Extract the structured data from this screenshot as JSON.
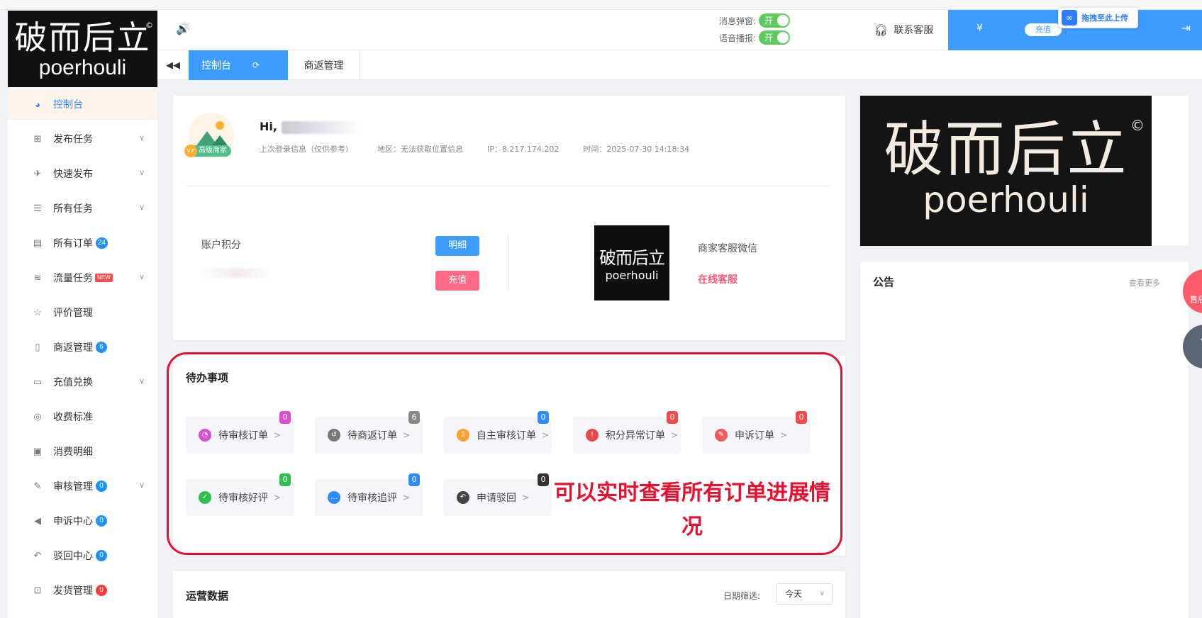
{
  "logo": {
    "cn": "破而后立",
    "en": "poerhouli",
    "reg": "©"
  },
  "sidebar": {
    "items": [
      {
        "label": "控制台",
        "icon": "dashboard-icon",
        "glyph": "◕",
        "active": true
      },
      {
        "label": "发布任务",
        "icon": "publish-icon",
        "glyph": "⊞",
        "chevron": true
      },
      {
        "label": "快速发布",
        "icon": "plane-icon",
        "glyph": "✈",
        "chevron": true
      },
      {
        "label": "所有任务",
        "icon": "task-list-icon",
        "glyph": "☰",
        "chevron": true
      },
      {
        "label": "所有订单",
        "icon": "order-icon",
        "glyph": "▤",
        "badge": "24"
      },
      {
        "label": "流量任务",
        "icon": "traffic-icon",
        "glyph": "≋",
        "newtag": "NEW",
        "chevron": true
      },
      {
        "label": "评价管理",
        "icon": "star-icon",
        "glyph": "☆"
      },
      {
        "label": "商返管理",
        "icon": "return-icon",
        "glyph": "▯",
        "badge": "6"
      },
      {
        "label": "充值兑换",
        "icon": "card-icon",
        "glyph": "▭",
        "chevron": true
      },
      {
        "label": "收费标准",
        "icon": "coins-icon",
        "glyph": "◎"
      },
      {
        "label": "消费明细",
        "icon": "receipt-icon",
        "glyph": "▣"
      },
      {
        "label": "审核管理",
        "icon": "edit-icon",
        "glyph": "✎",
        "badge": "0",
        "chevron": true
      },
      {
        "label": "申诉中心",
        "icon": "megaphone-icon",
        "glyph": "◀",
        "badge": "0"
      },
      {
        "label": "驳回中心",
        "icon": "undo-icon",
        "glyph": "↶",
        "badge": "0"
      },
      {
        "label": "发货管理",
        "icon": "gift-icon",
        "glyph": "⊡",
        "badge": "0",
        "badgeRed": true
      }
    ]
  },
  "header": {
    "msg_popup_label": "消息弹窗:",
    "voice_label": "语音播报:",
    "toggle_on": "开",
    "service_label": "联系客服",
    "recharge_label": "充值",
    "upload_label": "拖拽至此上传"
  },
  "tabs": [
    {
      "label": "控制台",
      "active": true
    },
    {
      "label": "商返管理",
      "active": false
    }
  ],
  "profile": {
    "hi": "Hi,",
    "vip_label": "高级商家",
    "vip_mark": "VIP",
    "last_login": "上次登录信息（仅供参考）",
    "region": "地区：无法获取位置信息",
    "ip": "IP：8.217.174.202",
    "time": "时间：2025-07-30 14:18:34",
    "points_label": "账户积分",
    "detail_btn": "明细",
    "recharge_btn": "充值",
    "qr_cn": "破而后立",
    "qr_en": "poerhouli",
    "wechat_label": "商家客服微信",
    "online_service": "在线客服"
  },
  "todo": {
    "title": "待办事项",
    "items": [
      {
        "label": "待审核订单",
        "count": "0",
        "icon": "clock-icon",
        "icolor": "#d84fd0",
        "ccolor": "#d84fd0",
        "glyph": "◔"
      },
      {
        "label": "待商返订单",
        "count": "6",
        "icon": "return-circle-icon",
        "icolor": "#777",
        "ccolor": "#888",
        "glyph": "↺"
      },
      {
        "label": "自主审核订单",
        "count": "0",
        "icon": "download-icon",
        "icolor": "#ff9f2e",
        "ccolor": "#2f8cff",
        "glyph": "⇩"
      },
      {
        "label": "积分异常订单",
        "count": "0",
        "icon": "alert-icon",
        "icolor": "#e84a4a",
        "ccolor": "#f04a4a",
        "glyph": "!"
      },
      {
        "label": "申诉订单",
        "count": "0",
        "icon": "appeal-icon",
        "icolor": "#f05a5a",
        "ccolor": "#f04a4a",
        "glyph": "✎"
      },
      {
        "label": "待审核好评",
        "count": "0",
        "icon": "thumb-up-icon",
        "icolor": "#2fbf4f",
        "ccolor": "#2fbf4f",
        "glyph": "✓"
      },
      {
        "label": "待审核追评",
        "count": "0",
        "icon": "more-icon",
        "icolor": "#2f8cff",
        "ccolor": "#2f8cff",
        "glyph": "…"
      },
      {
        "label": "申请驳回",
        "count": "0",
        "icon": "reject-icon",
        "icolor": "#444",
        "ccolor": "#333",
        "glyph": "↶"
      }
    ],
    "overlay": "可以实时查看所有订单进展情况"
  },
  "ops": {
    "title": "运营数据",
    "date_label": "日期筛选:",
    "date_value": "今天"
  },
  "banner": {
    "cn": "破而后立",
    "en": "poerhouli",
    "reg": "©"
  },
  "notice": {
    "title": "公告",
    "more": "查看更多"
  },
  "float": {
    "after_sale": "售后",
    "top": "↑"
  }
}
